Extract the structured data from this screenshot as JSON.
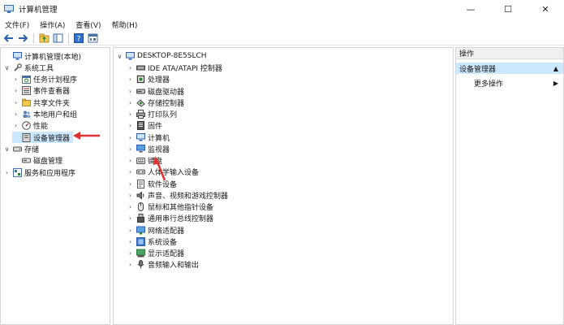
{
  "window": {
    "title": "计算机管理",
    "minimize": "—",
    "maximize": "☐",
    "close": "✕"
  },
  "menu": [
    "文件(F)",
    "操作(A)",
    "查看(V)",
    "帮助(H)"
  ],
  "left_tree": [
    {
      "label": "计算机管理(本地)",
      "level": 0,
      "arrow": "",
      "icon": "computer-management-icon"
    },
    {
      "label": "系统工具",
      "level": 1,
      "arrow": "∨",
      "icon": "system-tools-icon"
    },
    {
      "label": "任务计划程序",
      "level": 2,
      "arrow": "›",
      "icon": "task-scheduler-icon"
    },
    {
      "label": "事件查看器",
      "level": 2,
      "arrow": "›",
      "icon": "event-viewer-icon"
    },
    {
      "label": "共享文件夹",
      "level": 2,
      "arrow": "›",
      "icon": "shared-folders-icon"
    },
    {
      "label": "本地用户和组",
      "level": 2,
      "arrow": "›",
      "icon": "local-users-icon"
    },
    {
      "label": "性能",
      "level": 2,
      "arrow": "›",
      "icon": "performance-icon"
    },
    {
      "label": "设备管理器",
      "level": 2,
      "arrow": "",
      "icon": "device-manager-icon",
      "selected": true
    },
    {
      "label": "存储",
      "level": 1,
      "arrow": "∨",
      "icon": "storage-icon"
    },
    {
      "label": "磁盘管理",
      "level": 2,
      "arrow": "",
      "icon": "disk-management-icon"
    },
    {
      "label": "服务和应用程序",
      "level": 1,
      "arrow": "›",
      "icon": "services-apps-icon"
    }
  ],
  "device_root": "DESKTOP-8E5SLCH",
  "devices": [
    {
      "label": "IDE ATA/ATAPI 控制器",
      "icon": "ide-controller-icon"
    },
    {
      "label": "处理器",
      "icon": "processor-icon"
    },
    {
      "label": "磁盘驱动器",
      "icon": "disk-drive-icon"
    },
    {
      "label": "存储控制器",
      "icon": "storage-controller-icon"
    },
    {
      "label": "打印队列",
      "icon": "print-queue-icon"
    },
    {
      "label": "固件",
      "icon": "firmware-icon"
    },
    {
      "label": "计算机",
      "icon": "computer-icon"
    },
    {
      "label": "监视器",
      "icon": "monitor-icon"
    },
    {
      "label": "键盘",
      "icon": "keyboard-icon"
    },
    {
      "label": "人体学输入设备",
      "icon": "hid-icon"
    },
    {
      "label": "软件设备",
      "icon": "software-device-icon"
    },
    {
      "label": "声音、视频和游戏控制器",
      "icon": "sound-icon"
    },
    {
      "label": "鼠标和其他指针设备",
      "icon": "mouse-icon"
    },
    {
      "label": "通用串行总线控制器",
      "icon": "usb-icon"
    },
    {
      "label": "网络适配器",
      "icon": "network-adapter-icon"
    },
    {
      "label": "系统设备",
      "icon": "system-device-icon"
    },
    {
      "label": "显示适配器",
      "icon": "display-adapter-icon"
    },
    {
      "label": "音频输入和输出",
      "icon": "audio-io-icon"
    }
  ],
  "actions": {
    "header": "操作",
    "selected": "设备管理器",
    "more": "更多操作"
  },
  "colors": {
    "selection": "#cce8ff",
    "accent": "#1e64c8",
    "annotation_arrow": "#e03131"
  }
}
